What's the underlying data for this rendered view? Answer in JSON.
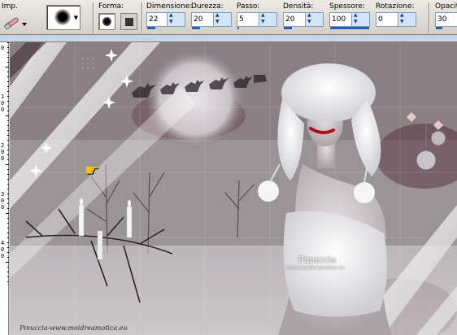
{
  "toolbar": {
    "preset_label": "Imp.",
    "shape_label": "Forma:",
    "fields": [
      {
        "label": "Dimensione:",
        "value": "22",
        "fill": 0.22
      },
      {
        "label": "Durezza:",
        "value": "20",
        "fill": 0.2
      },
      {
        "label": "Passo:",
        "value": "5",
        "fill": 0.05
      },
      {
        "label": "Densità:",
        "value": "20",
        "fill": 0.2
      },
      {
        "label": "Spessore:",
        "value": "100",
        "fill": 1.0
      },
      {
        "label": "Rotazione:",
        "value": "0",
        "fill": 0.0
      },
      {
        "label": "Opacit",
        "value": "30",
        "fill": 0.3
      }
    ]
  },
  "ruler": {
    "marks": [
      {
        "digits": [
          "0"
        ]
      },
      {
        "digits": [
          "1",
          "0",
          "0"
        ]
      },
      {
        "digits": [
          "2",
          "0",
          "0"
        ]
      },
      {
        "digits": [
          "3",
          "0",
          "0"
        ]
      },
      {
        "digits": [
          "4",
          "0",
          "0"
        ]
      }
    ]
  },
  "canvas": {
    "watermark_name": "Pinuccia",
    "watermark_url": "www.moidreamotica.eu",
    "signature": "Pinuccia-www.moidreamotica.eu"
  },
  "colors": {
    "toolbar_bg": "#d4d0c8",
    "accent_blue": "#2c5fb8",
    "lips_red": "#b0101e"
  }
}
